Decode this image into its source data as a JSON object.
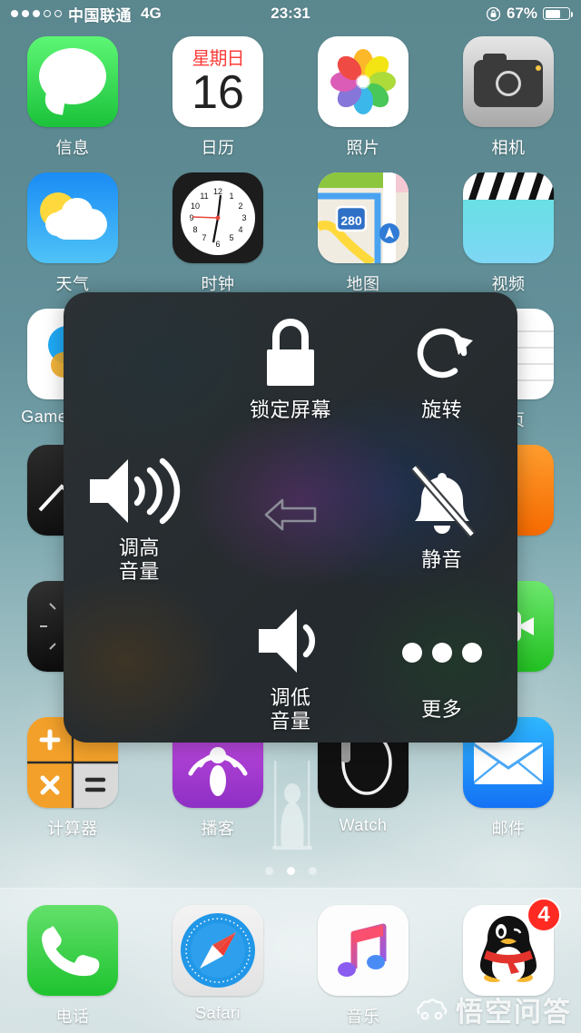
{
  "status_bar": {
    "signal_dots_filled": 3,
    "signal_dots_total": 5,
    "carrier": "中国联通",
    "network": "4G",
    "time": "23:31",
    "battery_percent": "67%",
    "battery_level": 67,
    "rotation_lock_icon": "rotation-lock-icon"
  },
  "home_screen": {
    "rows": [
      [
        {
          "label": "信息",
          "icon": "messages-icon",
          "app": "messages"
        },
        {
          "label": "日历",
          "icon": "calendar-icon",
          "app": "calendar",
          "weekday": "星期日",
          "date": "16"
        },
        {
          "label": "照片",
          "icon": "photos-icon",
          "app": "photos"
        },
        {
          "label": "相机",
          "icon": "camera-icon",
          "app": "camera"
        }
      ],
      [
        {
          "label": "天气",
          "icon": "weather-icon",
          "app": "weather"
        },
        {
          "label": "时钟",
          "icon": "clock-icon",
          "app": "clock"
        },
        {
          "label": "地图",
          "icon": "maps-icon",
          "app": "maps",
          "route_shield": "280"
        },
        {
          "label": "视频",
          "icon": "videos-icon",
          "app": "videos"
        }
      ],
      [
        {
          "label": "Game Center",
          "icon": "game-center-icon",
          "app": "gamecenter"
        },
        {
          "label": "",
          "icon": "notes-icon",
          "app": "notes"
        },
        {
          "label": "",
          "icon": "reminders-icon",
          "app": "reminders"
        },
        {
          "label": "主页",
          "icon": "home-icon",
          "app": "notes2"
        }
      ],
      [
        {
          "label": "",
          "icon": "stocks-icon",
          "app": "stocks"
        },
        {
          "label": "",
          "icon": "app-icon",
          "app": "hidden1"
        },
        {
          "label": "",
          "icon": "app-icon",
          "app": "hidden2"
        },
        {
          "label": "",
          "icon": "reminders-icon",
          "app": "reminders2"
        }
      ],
      [
        {
          "label": "",
          "icon": "compass-icon",
          "app": "compass"
        },
        {
          "label": "",
          "icon": "app-icon",
          "app": "hidden3"
        },
        {
          "label": "",
          "icon": "app-icon",
          "app": "hidden4"
        },
        {
          "label": "",
          "icon": "facetime-icon",
          "app": "facetime"
        }
      ],
      [
        {
          "label": "计算器",
          "icon": "calculator-icon",
          "app": "calculator"
        },
        {
          "label": "播客",
          "icon": "podcasts-icon",
          "app": "podcasts"
        },
        {
          "label": "Watch",
          "icon": "watch-icon",
          "app": "watch"
        },
        {
          "label": "邮件",
          "icon": "mail-icon",
          "app": "mail"
        }
      ]
    ]
  },
  "page_dots": {
    "count": 3,
    "active_index": 1
  },
  "dock": {
    "items": [
      {
        "label": "电话",
        "icon": "phone-icon",
        "app": "phone",
        "badge": ""
      },
      {
        "label": "Safari",
        "icon": "safari-icon",
        "app": "safari",
        "badge": ""
      },
      {
        "label": "音乐",
        "icon": "music-icon",
        "app": "music",
        "badge": ""
      },
      {
        "label": "QQ",
        "icon": "qq-icon",
        "app": "qq",
        "badge": "4"
      }
    ]
  },
  "assistive_touch": {
    "items": [
      {
        "label": "",
        "icon": "",
        "position": "top-left",
        "empty": true
      },
      {
        "label": "锁定屏幕",
        "icon": "lock-icon",
        "position": "top-center"
      },
      {
        "label": "旋转",
        "icon": "rotate-icon",
        "position": "top-right"
      },
      {
        "label": "调高音量",
        "icon": "volume-up-icon",
        "position": "middle-left"
      },
      {
        "label": "",
        "icon": "back-arrow-icon",
        "position": "middle-center"
      },
      {
        "label": "静音",
        "icon": "mute-bell-icon",
        "position": "middle-right"
      },
      {
        "label": "",
        "icon": "",
        "position": "bottom-left",
        "empty": true
      },
      {
        "label": "调低音量",
        "icon": "volume-down-icon",
        "position": "bottom-center"
      },
      {
        "label": "更多",
        "icon": "more-dots-icon",
        "position": "bottom-right"
      }
    ]
  },
  "watermark": {
    "text": "悟空问答",
    "logo": "cloud-logo"
  },
  "colors": {
    "accent_green": "#1ec32f",
    "badge_red": "#ff2a21",
    "calendar_red": "#fc3d39",
    "wallpaper_teal": "#5d8a92",
    "panel_dark": "#33393d"
  }
}
